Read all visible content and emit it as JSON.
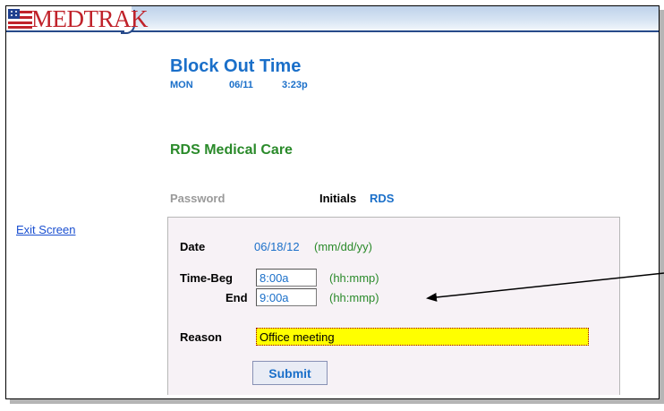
{
  "app": {
    "logo_text": "MEDTRAK"
  },
  "header": {
    "title": "Block Out Time",
    "day": "MON",
    "date": "06/11",
    "time": "3:23p"
  },
  "practice_name": "RDS Medical Care",
  "password_label": "Password",
  "initials_label": "Initials",
  "initials_value": "RDS",
  "exit_link": "Exit Screen",
  "form": {
    "date_label": "Date",
    "date_value": "06/18/12",
    "date_hint": "(mm/dd/yy)",
    "time_beg_label": "Time-Beg",
    "time_beg_value": "8:00a",
    "time_beg_hint": "(hh:mmp)",
    "end_label": "End",
    "end_value": "9:00a",
    "end_hint": "(hh:mmp)",
    "reason_label": "Reason",
    "reason_value": "Office meeting",
    "submit_label": "Submit"
  },
  "colors": {
    "title_blue": "#1a6fc9",
    "practice_green": "#2a8a2a",
    "logo_red": "#c0222a",
    "reason_highlight": "#ffff00"
  }
}
